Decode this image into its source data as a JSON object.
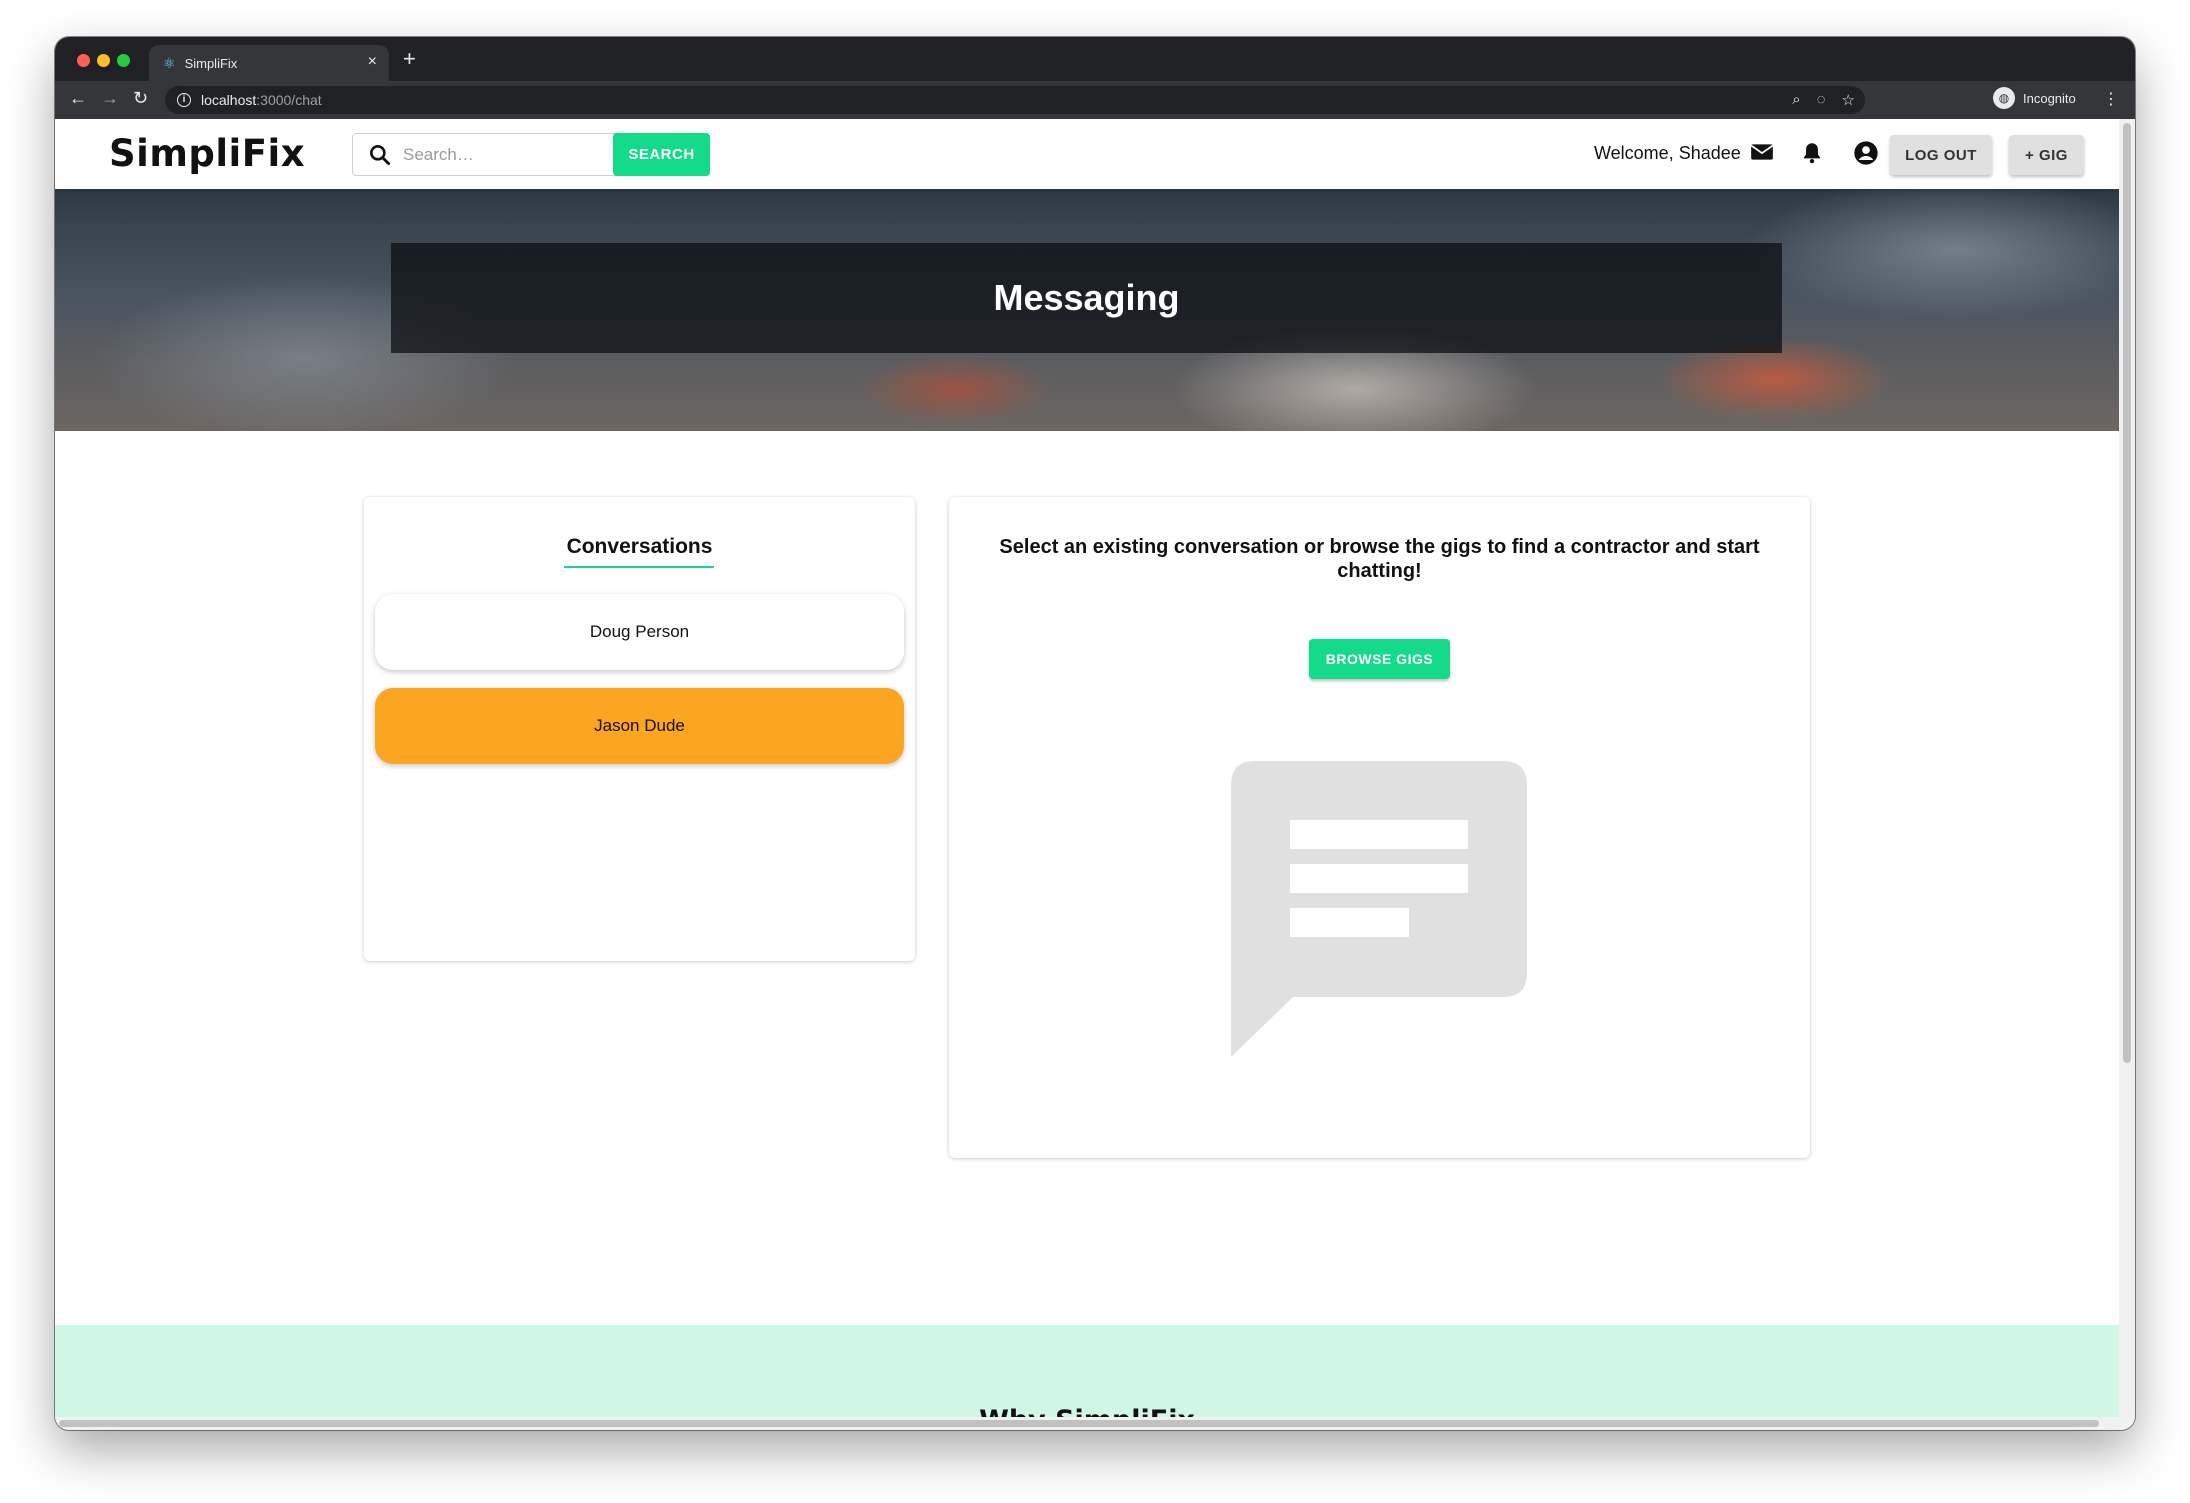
{
  "browser": {
    "tab_title": "SimpliFix",
    "tab_close": "×",
    "new_tab": "+",
    "url_host": "localhost",
    "url_path": ":3000/chat",
    "profile_label": "Incognito"
  },
  "header": {
    "logo": "SimpliFix",
    "search_placeholder": "Search…",
    "search_button": "SEARCH",
    "welcome": "Welcome, Shadee",
    "logout_button": "LOG OUT",
    "add_gig_button": "+ GIG"
  },
  "hero": {
    "title": "Messaging"
  },
  "conversations": {
    "title": "Conversations",
    "items": [
      {
        "name": "Doug Person",
        "selected": false
      },
      {
        "name": "Jason Dude",
        "selected": true
      }
    ]
  },
  "chat": {
    "empty_message": "Select an existing conversation or browse the gigs to find a contractor and start chatting!",
    "browse_button": "BROWSE GIGS"
  },
  "footer_section": {
    "title": "Why SimpliFix"
  },
  "colors": {
    "accent_green": "#14db8a",
    "selected_orange": "#fca520",
    "why_bg": "#d0f7e6"
  },
  "icons": {
    "search": "search-icon",
    "mail": "mail-icon",
    "bell": "bell-icon",
    "account": "account-circle-icon",
    "chat": "chat-bubble-icon"
  }
}
